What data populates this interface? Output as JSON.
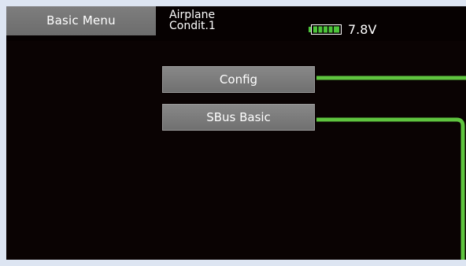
{
  "header": {
    "menu_tab": "Basic Menu",
    "model_type": "Airplane",
    "condition": "Condit.1",
    "battery_icon": "battery-full-icon",
    "voltage": "7.8V"
  },
  "menu": {
    "items": [
      {
        "label": "Config"
      },
      {
        "label": "SBus Basic"
      }
    ]
  },
  "colors": {
    "background": "#0a0303",
    "frame": "#dde5f2",
    "button": "#7c7c7c",
    "connector": "#5fc43f",
    "battery": "#4cc43a"
  }
}
